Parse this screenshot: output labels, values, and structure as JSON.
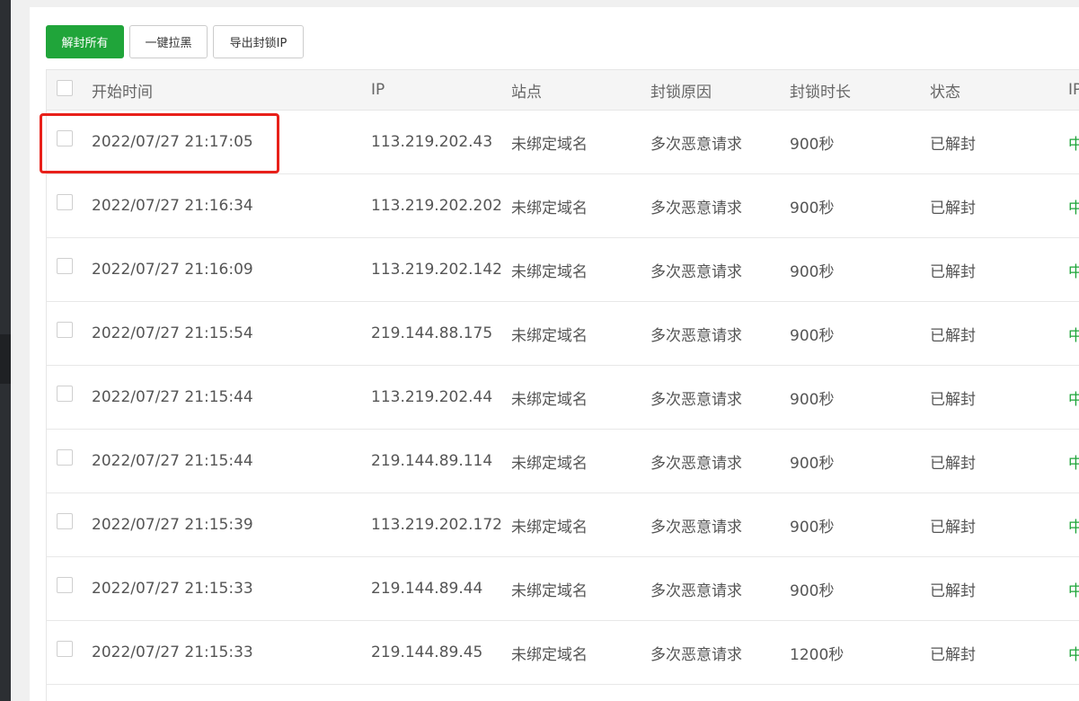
{
  "toolbar": {
    "unblock_all": "解封所有",
    "blacklist_all": "一键拉黑",
    "export_ips": "导出封锁IP"
  },
  "table": {
    "headers": {
      "time": "开始时间",
      "ip": "IP",
      "site": "站点",
      "reason": "封锁原因",
      "duration": "封锁时长",
      "status": "状态",
      "location": "IP"
    },
    "rows": [
      {
        "time": "2022/07/27 21:17:05",
        "ip": "113.219.202.43",
        "site": "未绑定域名",
        "reason": "多次恶意请求",
        "duration": "900秒",
        "status": "已解封",
        "location": "中"
      },
      {
        "time": "2022/07/27 21:16:34",
        "ip": "113.219.202.202",
        "site": "未绑定域名",
        "reason": "多次恶意请求",
        "duration": "900秒",
        "status": "已解封",
        "location": "中"
      },
      {
        "time": "2022/07/27 21:16:09",
        "ip": "113.219.202.142",
        "site": "未绑定域名",
        "reason": "多次恶意请求",
        "duration": "900秒",
        "status": "已解封",
        "location": "中"
      },
      {
        "time": "2022/07/27 21:15:54",
        "ip": "219.144.88.175",
        "site": "未绑定域名",
        "reason": "多次恶意请求",
        "duration": "900秒",
        "status": "已解封",
        "location": "中"
      },
      {
        "time": "2022/07/27 21:15:44",
        "ip": "113.219.202.44",
        "site": "未绑定域名",
        "reason": "多次恶意请求",
        "duration": "900秒",
        "status": "已解封",
        "location": "中"
      },
      {
        "time": "2022/07/27 21:15:44",
        "ip": "219.144.89.114",
        "site": "未绑定域名",
        "reason": "多次恶意请求",
        "duration": "900秒",
        "status": "已解封",
        "location": "中"
      },
      {
        "time": "2022/07/27 21:15:39",
        "ip": "113.219.202.172",
        "site": "未绑定域名",
        "reason": "多次恶意请求",
        "duration": "900秒",
        "status": "已解封",
        "location": "中"
      },
      {
        "time": "2022/07/27 21:15:33",
        "ip": "219.144.89.44",
        "site": "未绑定域名",
        "reason": "多次恶意请求",
        "duration": "900秒",
        "status": "已解封",
        "location": "中"
      },
      {
        "time": "2022/07/27 21:15:33",
        "ip": "219.144.89.45",
        "site": "未绑定域名",
        "reason": "多次恶意请求",
        "duration": "1200秒",
        "status": "已解封",
        "location": "中"
      }
    ]
  },
  "colors": {
    "primary_green": "#20a53a",
    "highlight_red": "#e8201a",
    "header_bg": "#f5f5f5"
  }
}
